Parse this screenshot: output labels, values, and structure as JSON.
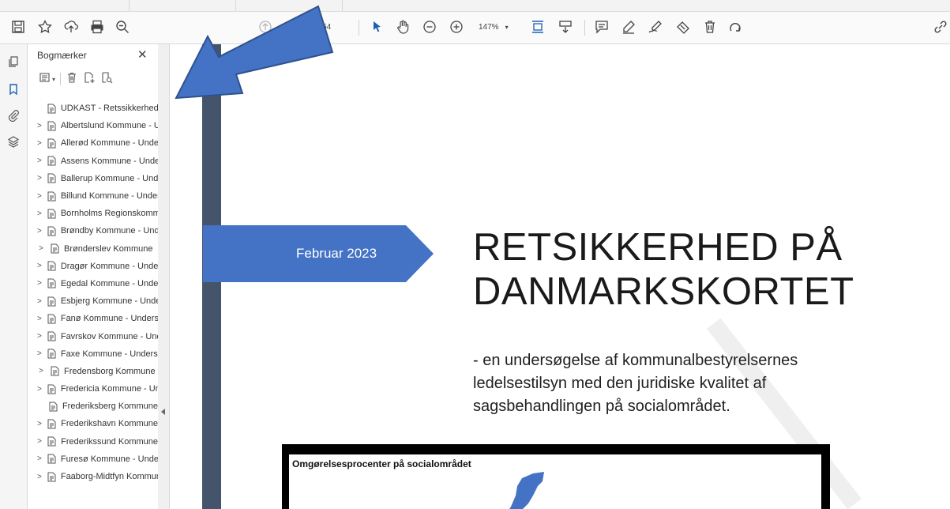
{
  "toolbar": {
    "page_total": "/ 154",
    "zoom": "147%",
    "icons": [
      "save-icon",
      "star-icon",
      "upload-icon",
      "print-icon",
      "search-icon",
      "page-up-icon",
      "page-down-icon",
      "select-icon",
      "hand-icon",
      "zoom-out-icon",
      "zoom-in-icon",
      "fit-page-icon",
      "scroll-icon",
      "comment-icon",
      "highlight-icon",
      "sign-icon",
      "redact-icon",
      "delete-icon",
      "rotate-icon",
      "link-icon"
    ]
  },
  "panel": {
    "title": "Bogmærker",
    "close": "✕",
    "bookmarks": [
      {
        "label": "UDKAST - Retssikkerhed",
        "expandable": false
      },
      {
        "label": "Albertslund Kommune - Undersøgelse",
        "expandable": true
      },
      {
        "label": "Allerød Kommune - Undersøgelse",
        "expandable": true
      },
      {
        "label": "Assens Kommune - Undersøgelse",
        "expandable": true
      },
      {
        "label": "Ballerup Kommune - Undersøgelse",
        "expandable": true
      },
      {
        "label": "Billund Kommune - Undersøgelse",
        "expandable": true
      },
      {
        "label": "Bornholms Regionskommune",
        "expandable": true
      },
      {
        "label": "Brøndby Kommune - Undersøgelse",
        "expandable": true
      },
      {
        "label": "Brønderslev Kommune",
        "expandable": true
      },
      {
        "label": "Dragør Kommune - Undersøgelse",
        "expandable": true
      },
      {
        "label": "Egedal Kommune - Undersøgelse",
        "expandable": true
      },
      {
        "label": "Esbjerg Kommune - Undersøgelse",
        "expandable": true
      },
      {
        "label": "Fanø Kommune - Undersøgelse",
        "expandable": true
      },
      {
        "label": "Favrskov Kommune - Undersøgelse",
        "expandable": true
      },
      {
        "label": "Faxe Kommune - Undersøgelse",
        "expandable": true
      },
      {
        "label": "Fredensborg Kommune",
        "expandable": true
      },
      {
        "label": "Fredericia Kommune - Undersøgelse",
        "expandable": true
      },
      {
        "label": "Frederiksberg Kommune",
        "expandable": false
      },
      {
        "label": "Frederikshavn Kommune",
        "expandable": true
      },
      {
        "label": "Frederikssund Kommune",
        "expandable": true
      },
      {
        "label": "Furesø Kommune - Undersøgelse",
        "expandable": true
      },
      {
        "label": "Faaborg-Midtfyn Kommune",
        "expandable": true
      }
    ]
  },
  "document": {
    "date_label": "Februar 2023",
    "title_line1": "RETSIKKERHED PÅ",
    "title_line2": "DANMARKSKORTET",
    "subtitle": "- en undersøgelse af kommunalbestyrelsernes ledelsestilsyn med den juridiske kvalitet af sagsbehandlingen på socialområdet.",
    "map_title": "Omgørelsesprocenter på socialområdet"
  },
  "colors": {
    "accent": "#4472c4",
    "timeline": "#44546a",
    "arrow": "#4472c4"
  }
}
